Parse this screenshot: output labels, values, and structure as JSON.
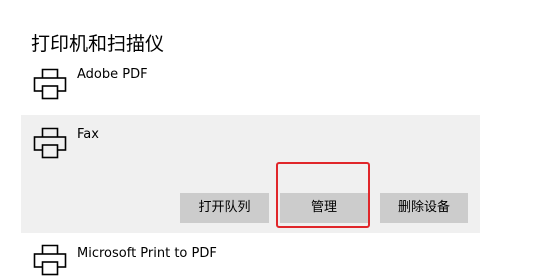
{
  "section": {
    "title": "打印机和扫描仪"
  },
  "printers": [
    {
      "name": "Adobe PDF",
      "icon": "printer-icon"
    },
    {
      "name": "Fax",
      "icon": "printer-icon"
    },
    {
      "name": "Microsoft Print to PDF",
      "icon": "printer-icon"
    }
  ],
  "selected_printer_actions": {
    "open_queue_label": "打开队列",
    "manage_label": "管理",
    "remove_device_label": "删除设备"
  },
  "colors": {
    "selected_row_bg": "#f0f0f0",
    "button_bg": "#cccccc",
    "highlight": "#e0262a"
  }
}
